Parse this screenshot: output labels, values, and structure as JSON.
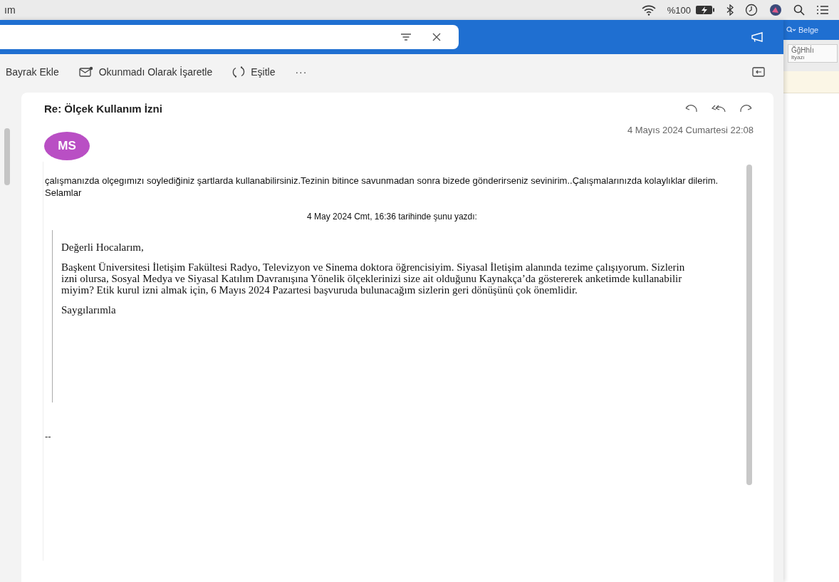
{
  "menu_bar": {
    "app_menu": "ım",
    "battery_percent": "%100"
  },
  "toolbar": {
    "actions": [
      {
        "label": "Bayrak Ekle",
        "kind": "plain"
      },
      {
        "label": "Okunmadı Olarak İşaretle",
        "kind": "unread"
      },
      {
        "label": "Eşitle",
        "kind": "sync"
      }
    ],
    "more": "···"
  },
  "message": {
    "subject": "Re: Ölçek Kullanım İzni",
    "avatar": "MS",
    "date": "4 Mayıs 2024 Cumartesi 22:08",
    "reply": [
      "çalışmanızda olçegımızı soylediğiniz şartlarda kullanabilirsiniz.Tezinin bitince savunmadan sonra bizede gönderirseniz sevinirim..Çalışmalarınızda kolaylıklar dilerim.",
      "Selamlar"
    ],
    "quote_header": "4 May 2024 Cmt, 16:36 tarihinde şunu yazdı:",
    "quote": [
      "Değerli Hocalarım,",
      "Başkent Üniversitesi İletişim Fakültesi Radyo, Televizyon ve Sinema doktora öğrencisiyim. Siyasal İletişim alanında tezime çalışıyorum. Sizlerin izni olursa, Sosyal Medya ve Siyasal Katılım Davranışına Yönelik ölçeklerinizi size ait olduğunu Kaynakça’da göstererek  anketimde kullanabilir miyim? Etik kurul izni almak için, 6 Mayıs 2024 Pazartesi başvuruda bulunacağım sizlerin geri dönüşünü çok önemlidir.",
      "Saygılarımla"
    ],
    "signature": "--"
  },
  "side_window": {
    "search": "Belge",
    "style_sample": "ĞğHhİı",
    "style_name": "ltyazı"
  }
}
